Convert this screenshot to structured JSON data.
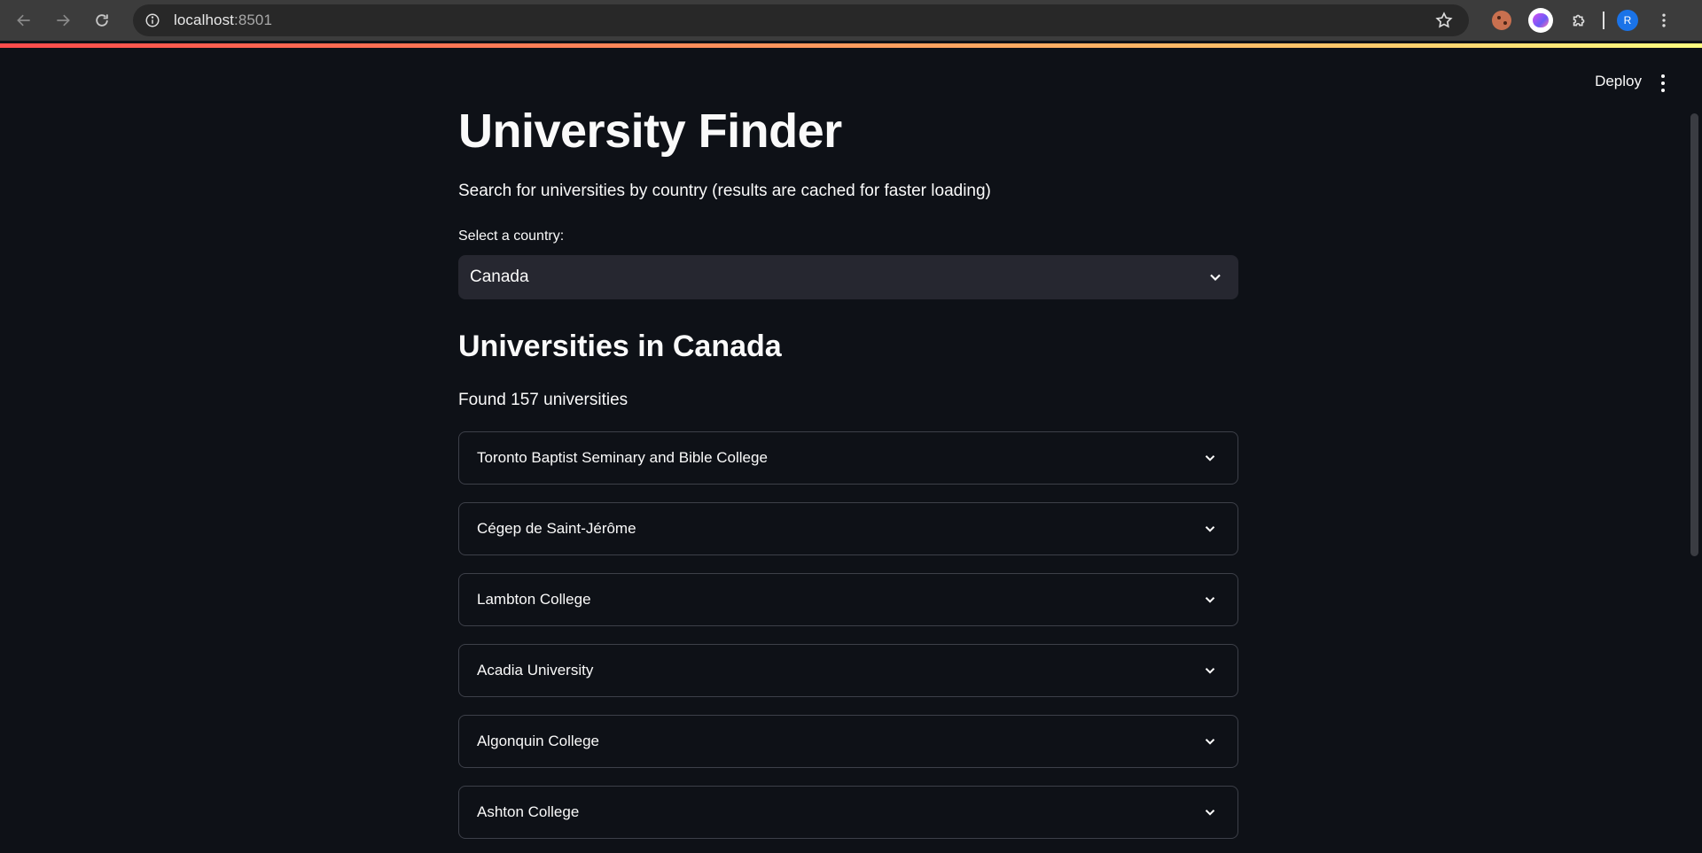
{
  "browser": {
    "url_host": "localhost",
    "url_port": ":8501",
    "profile_initial": "R"
  },
  "app": {
    "deploy_label": "Deploy",
    "title": "University Finder",
    "subtitle": "Search for universities by country (results are cached for faster loading)",
    "select_label": "Select a country:",
    "selected_country": "Canada",
    "section_heading": "Universities in Canada",
    "found_text": "Found 157 universities",
    "universities": [
      "Toronto Baptist Seminary and Bible College",
      "Cégep de Saint-Jérôme",
      "Lambton College",
      "Acadia University",
      "Algonquin College",
      "Ashton College"
    ]
  },
  "colors": {
    "background": "#0e1117",
    "select_background": "#262730",
    "expander_border": "#3d4049",
    "accent_gradient_start": "#ff4b4b",
    "accent_gradient_end": "#fffd80",
    "avatar": "#1a73e8"
  },
  "icons": [
    "back-arrow-icon",
    "forward-arrow-icon",
    "reload-icon",
    "site-info-icon",
    "star-icon",
    "cookie-extension-icon",
    "brain-extension-icon",
    "puzzle-extensions-icon",
    "kebab-menu-icon",
    "chevron-down-icon"
  ]
}
